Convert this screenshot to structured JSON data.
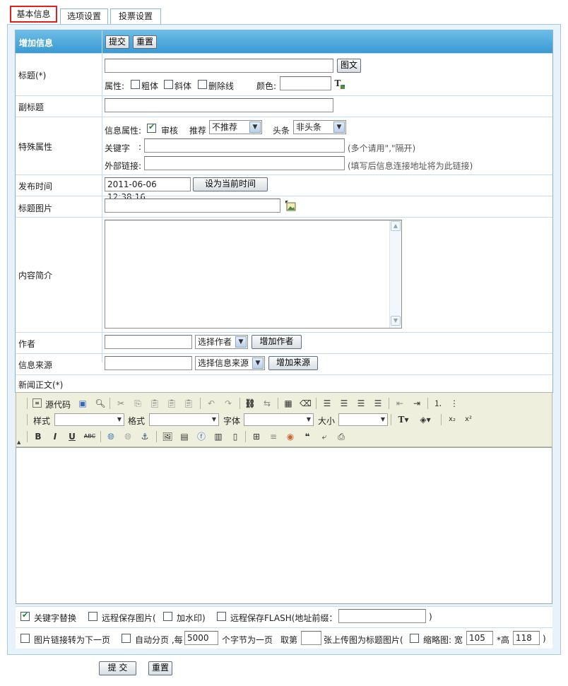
{
  "tabs": [
    "基本信息",
    "选项设置",
    "投票设置"
  ],
  "header": {
    "title": "增加信息",
    "submit": "提交",
    "reset": "重置"
  },
  "title_row": {
    "label": "标题(*)",
    "value": "",
    "tuwen_button": "图文",
    "attr_label": "属性:",
    "bold": "粗体",
    "italic": "斜体",
    "strike": "删除线",
    "color_label": "颜色:",
    "color_value": ""
  },
  "subtitle_row": {
    "label": "副标题",
    "value": ""
  },
  "special_row": {
    "label": "特殊属性",
    "info_attr": "信息属性:",
    "audit": "审核",
    "recommend_label": "推荐",
    "recommend_value": "不推荐",
    "headline_label": "头条",
    "headline_value": "非头条",
    "keyword_label": "关键字",
    "keyword_colon": ":",
    "keyword_hint": "(多个请用\",\"隔开)",
    "link_label": "外部链接:",
    "link_hint": "(填写后信息连接地址将为此链接)"
  },
  "publish_row": {
    "label": "发布时间",
    "value": "2011-06-06 12:38:16",
    "button": "设为当前时间"
  },
  "title_image_row": {
    "label": "标题图片",
    "value": ""
  },
  "summary_row": {
    "label": "内容简介"
  },
  "author_row": {
    "label": "作者",
    "select": "选择作者",
    "button": "增加作者"
  },
  "source_row": {
    "label": "信息来源",
    "select": "选择信息来源",
    "button": "增加来源"
  },
  "body_row": {
    "label": "新闻正文(*)"
  },
  "toolbar": {
    "source": "源代码",
    "style_label": "样式",
    "format_label": "格式",
    "font_label": "字体",
    "size_label": "大小"
  },
  "options1": {
    "keyword_replace": "关键字替换",
    "remote_save_img": "远程保存图片(",
    "watermark": "加水印)",
    "remote_flash": "远程保存FLASH(地址前缀：",
    "flash_close": ")"
  },
  "options2": {
    "img_next": "图片链接转为下一页",
    "auto_page": "自动分页 ,每",
    "page_size": "5000",
    "page_unit": "个字节为一页",
    "take_label": "取第",
    "take_value": "",
    "take_suffix": "张上传图为标题图片(",
    "thumb_label": "缩略图: 宽",
    "thumb_width": "105",
    "thumb_height_label": "*高",
    "thumb_height": "118",
    "close": ")"
  },
  "footer": {
    "submit": "提 交",
    "reset": "重置"
  }
}
